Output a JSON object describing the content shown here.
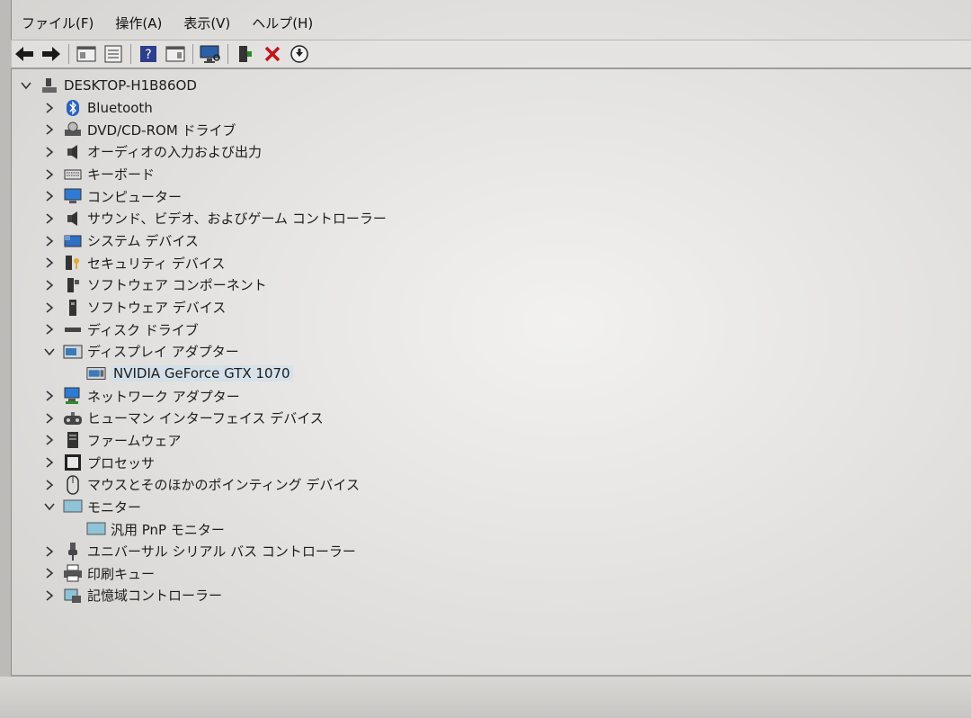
{
  "menubar": {
    "items": [
      "ファイル(F)",
      "操作(A)",
      "表示(V)",
      "ヘルプ(H)"
    ]
  },
  "toolbar": {
    "buttons": [
      "back-icon",
      "forward-icon",
      "console-tree-icon",
      "properties-icon",
      "help-icon",
      "action-pane-icon",
      "scan-hardware-icon",
      "update-driver-icon",
      "uninstall-icon",
      "disable-icon"
    ]
  },
  "tree": {
    "root": "DESKTOP-H1B86OD",
    "nodes": [
      {
        "label": "Bluetooth",
        "expanded": false,
        "icon": "bluetooth-icon"
      },
      {
        "label": "DVD/CD-ROM ドライブ",
        "expanded": false,
        "icon": "dvd-drive-icon"
      },
      {
        "label": "オーディオの入力および出力",
        "expanded": false,
        "icon": "speaker-icon"
      },
      {
        "label": "キーボード",
        "expanded": false,
        "icon": "keyboard-icon"
      },
      {
        "label": "コンピューター",
        "expanded": false,
        "icon": "computer-icon"
      },
      {
        "label": "サウンド、ビデオ、およびゲーム コントローラー",
        "expanded": false,
        "icon": "sound-icon"
      },
      {
        "label": "システム デバイス",
        "expanded": false,
        "icon": "system-devices-icon"
      },
      {
        "label": "セキュリティ デバイス",
        "expanded": false,
        "icon": "security-key-icon"
      },
      {
        "label": "ソフトウェア コンポーネント",
        "expanded": false,
        "icon": "software-component-icon"
      },
      {
        "label": "ソフトウェア デバイス",
        "expanded": false,
        "icon": "software-device-icon"
      },
      {
        "label": "ディスク ドライブ",
        "expanded": false,
        "icon": "disk-drive-icon"
      },
      {
        "label": "ディスプレイ アダプター",
        "expanded": true,
        "icon": "display-adapter-icon",
        "children": [
          {
            "label": "NVIDIA GeForce GTX 1070",
            "icon": "gpu-icon",
            "selected": true
          }
        ]
      },
      {
        "label": "ネットワーク アダプター",
        "expanded": false,
        "icon": "network-adapter-icon"
      },
      {
        "label": "ヒューマン インターフェイス デバイス",
        "expanded": false,
        "icon": "hid-icon"
      },
      {
        "label": "ファームウェア",
        "expanded": false,
        "icon": "firmware-icon"
      },
      {
        "label": "プロセッサ",
        "expanded": false,
        "icon": "processor-icon"
      },
      {
        "label": "マウスとそのほかのポインティング デバイス",
        "expanded": false,
        "icon": "mouse-icon"
      },
      {
        "label": "モニター",
        "expanded": true,
        "icon": "monitor-icon",
        "children": [
          {
            "label": "汎用 PnP モニター",
            "icon": "monitor-icon",
            "selected": false
          }
        ]
      },
      {
        "label": "ユニバーサル シリアル バス コントローラー",
        "expanded": false,
        "icon": "usb-icon"
      },
      {
        "label": "印刷キュー",
        "expanded": false,
        "icon": "printer-icon"
      },
      {
        "label": "記憶域コントローラー",
        "expanded": false,
        "icon": "storage-controller-icon"
      }
    ]
  }
}
